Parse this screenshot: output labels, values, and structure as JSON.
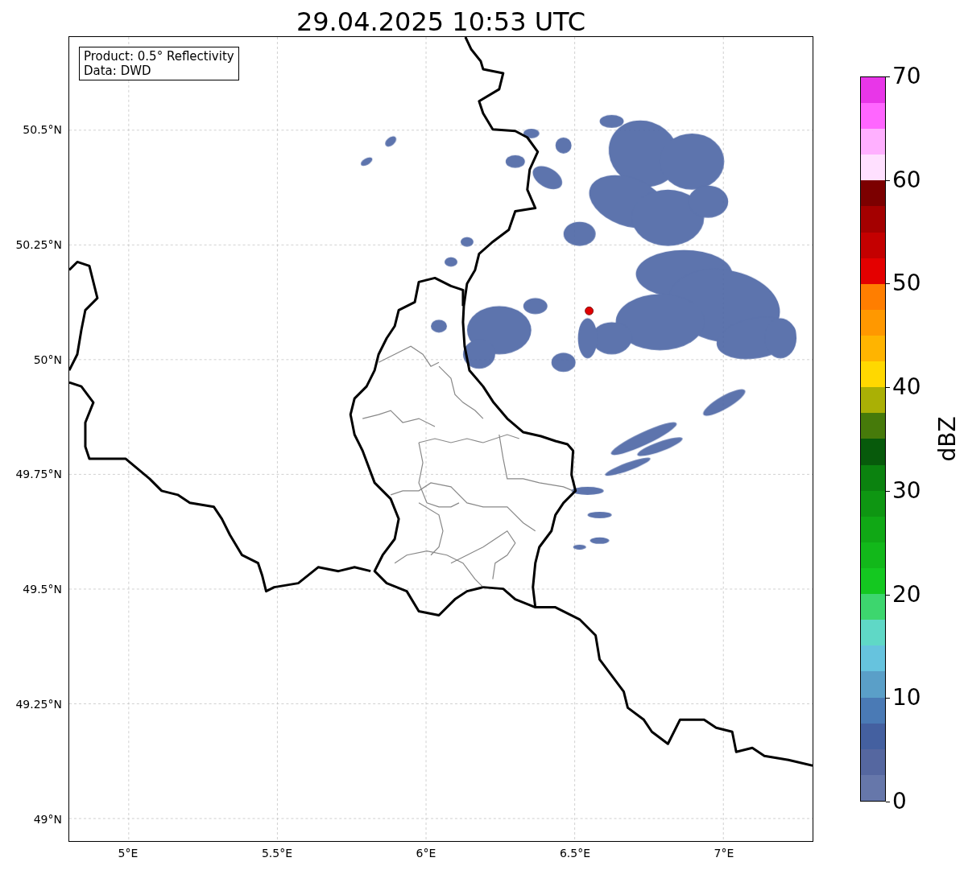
{
  "title": "29.04.2025 10:53 UTC",
  "legend": [
    "Product: 0.5° Reflectivity",
    "Data: DWD"
  ],
  "map": {
    "lat_ticks": [
      "50.5°N",
      "50.25°N",
      "50°N",
      "49.75°N",
      "49.5°N",
      "49.25°N",
      "49°N"
    ],
    "lon_ticks": [
      "5°E",
      "5.5°E",
      "6°E",
      "6.5°E",
      "7°E"
    ]
  },
  "colorbar": {
    "label": "dBZ",
    "ticks": [
      "70",
      "60",
      "50",
      "40",
      "30",
      "20",
      "10",
      "0"
    ],
    "segments": [
      {
        "color": "#6677aa"
      },
      {
        "color": "#5567a0"
      },
      {
        "color": "#4460a0"
      },
      {
        "color": "#4a7ab5"
      },
      {
        "color": "#5a9fc8"
      },
      {
        "color": "#66c3de"
      },
      {
        "color": "#5fd8c6"
      },
      {
        "color": "#3dd66e"
      },
      {
        "color": "#14c820"
      },
      {
        "color": "#12b81a"
      },
      {
        "color": "#10a815"
      },
      {
        "color": "#0e9612"
      },
      {
        "color": "#0b820f"
      },
      {
        "color": "#075a0b"
      },
      {
        "color": "#467a0a"
      },
      {
        "color": "#aab005"
      },
      {
        "color": "#ffd800"
      },
      {
        "color": "#ffb400"
      },
      {
        "color": "#ff9800"
      },
      {
        "color": "#ff7e00"
      },
      {
        "color": "#e40000"
      },
      {
        "color": "#c40000"
      },
      {
        "color": "#a40000"
      },
      {
        "color": "#7c0000"
      },
      {
        "color": "#ffe0ff"
      },
      {
        "color": "#ffb0ff"
      },
      {
        "color": "#ff66ff"
      },
      {
        "color": "#e836e8"
      }
    ]
  }
}
